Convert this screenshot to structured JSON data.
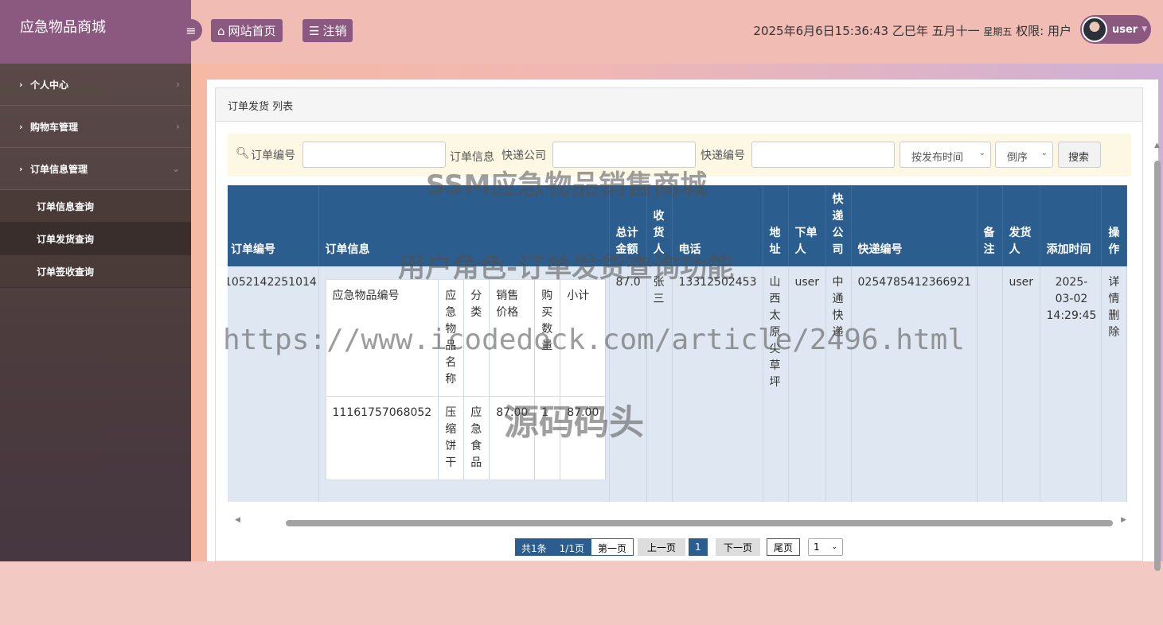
{
  "app": {
    "title": "应急物品商城"
  },
  "sidebar": {
    "items": [
      {
        "label": "个人中心"
      },
      {
        "label": "购物车管理"
      },
      {
        "label": "订单信息管理"
      }
    ],
    "subitems": [
      {
        "label": "订单信息查询"
      },
      {
        "label": "订单发货查询"
      },
      {
        "label": "订单签收查询"
      }
    ]
  },
  "topbar": {
    "home": "网站首页",
    "logout": "注销",
    "datetime": "2025年6月6日15:36:43 乙巳年 五月十一",
    "weekday": "星期五",
    "role": "权限: 用户",
    "user": "user"
  },
  "panel": {
    "title": "订单发货 列表"
  },
  "search": {
    "label_order_no": "订单编号",
    "label_order_info": "订单信息",
    "label_express_co": "快递公司",
    "label_express_no": "快递编号",
    "sort_field": "按发布时间",
    "sort_order": "倒序",
    "button": "搜索"
  },
  "table": {
    "headers": [
      "订单编号",
      "订单信息",
      "总计金额",
      "收货人",
      "电话",
      "地址",
      "下单人",
      "快递公司",
      "快递编号",
      "备注",
      "发货人",
      "添加时间",
      "操作"
    ],
    "rows": [
      {
        "order_no": "1052142251014",
        "total": "87.0",
        "receiver": "张三",
        "phone": "13312502453",
        "address": "山西太原尖草坪",
        "orderer": "user",
        "express_co": "中通快递",
        "express_no": "0254785412366921",
        "remark": "",
        "shipper": "user",
        "time": "2025-03-02 14:29:45",
        "actions": "详情删除"
      }
    ],
    "inner_headers": [
      "应急物品编号",
      "应急物品名称",
      "分类",
      "销售价格",
      "购买数量",
      "小计"
    ],
    "inner_row": [
      "11161757068052",
      "压缩饼干",
      "应急食品",
      "87.00",
      "1",
      "87.00"
    ]
  },
  "pager": {
    "summary": "共1条",
    "pages": "1/1页",
    "first": "第一页",
    "prev": "上一页",
    "current": "1",
    "next": "下一页",
    "last": "尾页",
    "select": "1"
  },
  "watermarks": {
    "w1": "SSM应急物品销售商城",
    "w2": "用户角色-订单发货查询功能",
    "w3": "https://www.icodedock.com/article/2496.html",
    "w4": "源码码头"
  },
  "colors": {
    "sidebar": "#4c3c3d",
    "brand": "#8b5880",
    "table_header": "#2b5e8f",
    "topbar": "#f1bcb4"
  }
}
